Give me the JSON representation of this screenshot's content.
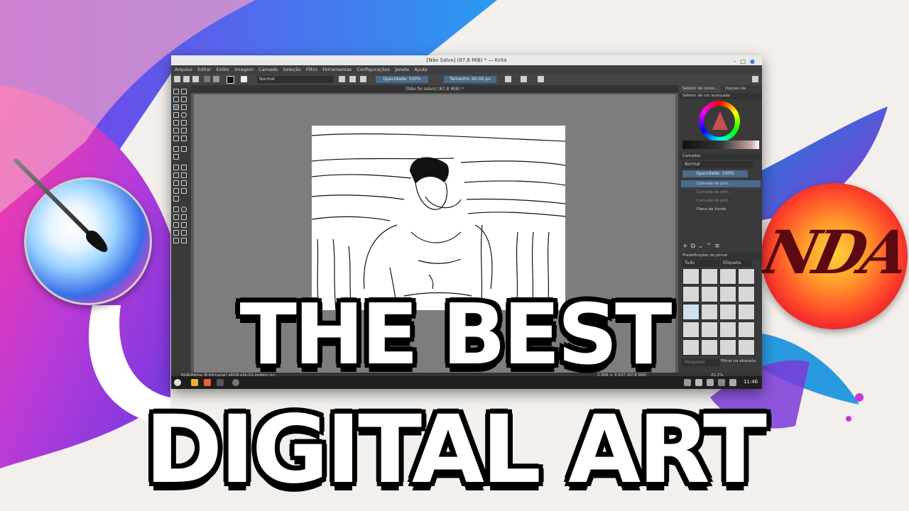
{
  "headline": {
    "line1": "THE BEST",
    "line2": "DIGITAL ART"
  },
  "logos": {
    "right_logo_text": "NDA"
  },
  "window": {
    "title": "[Não Salvo] (87,8 MiB) * — Krita",
    "menu": [
      "Arquivo",
      "Editar",
      "Exibir",
      "Imagem",
      "Camada",
      "Seleção",
      "Filtro",
      "Ferramentas",
      "Configurações",
      "Janela",
      "Ajuda"
    ],
    "toolbar": {
      "blend_mode": "Normal",
      "opacity": "Opacidade: 100%",
      "size": "Tamanho: 40,00 px"
    },
    "document_tab": "[Não foi salvo] (87,8 MiB) *",
    "dock": {
      "tab_color": "Seletor de cores...",
      "tab_tool": "Opções de ferra...",
      "color_panel_title": "Seletor de cor avançado",
      "layers_title": "Camadas",
      "layers_blend": "Normal",
      "layers_opacity": "Opacidade: 100%",
      "layers": [
        {
          "name": "Camada de pint...",
          "selected": true
        },
        {
          "name": "Camada de pint...",
          "selected": false
        },
        {
          "name": "Camada de pint...",
          "selected": false
        },
        {
          "name": "Plano de fundo",
          "selected": false
        }
      ],
      "presets_title": "Predefinições do pincel",
      "presets_filter": "Tudo",
      "presets_tag": "Etiqueta",
      "search_placeholder": "Pesquisar",
      "filter_label": "Filtrar na etiqueta"
    },
    "statusbar": {
      "left": "RGB/Alpha (8-bit/canal) sRGB-elle-V2-srgbtrc.icc",
      "size": "2.968 × 3.507 (87,8 MiB)",
      "zoom": "22,2%"
    },
    "taskbar": {
      "clock": "11:46"
    }
  },
  "colors": {
    "krita_accent": "#4a6b8c",
    "nda_red": "#e8142a"
  }
}
